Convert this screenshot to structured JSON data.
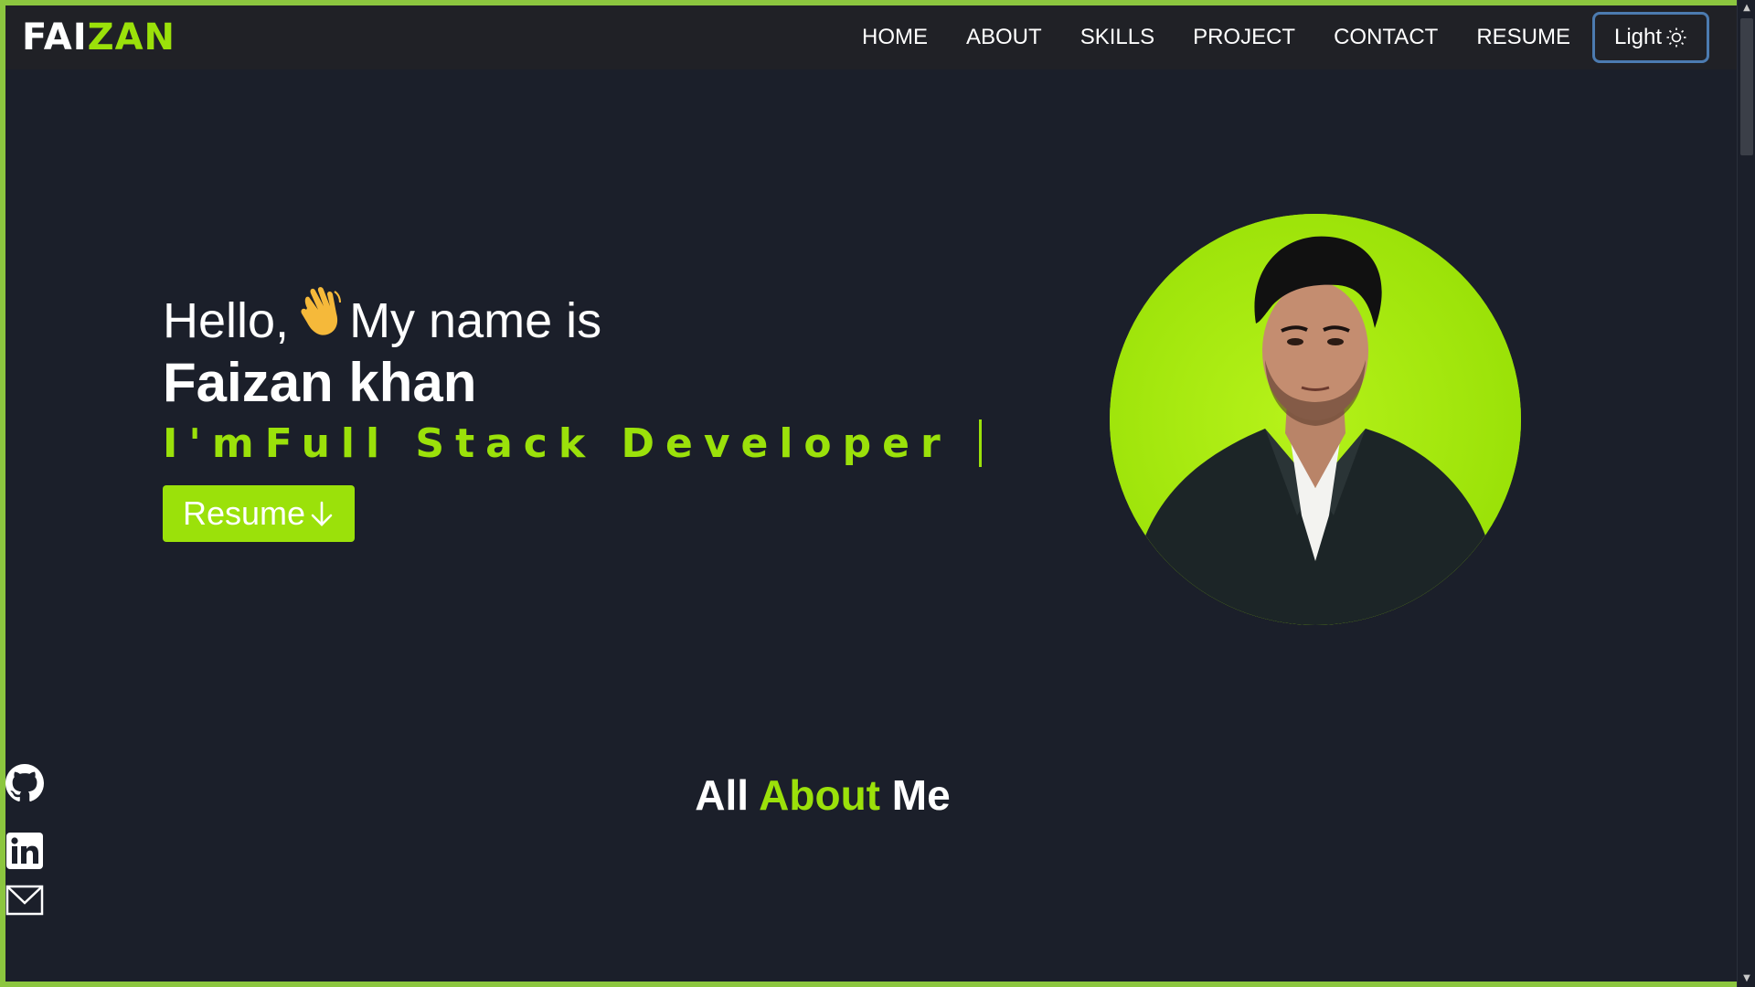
{
  "logo": {
    "part1": "FAI",
    "part2": "ZAN"
  },
  "nav": {
    "items": [
      {
        "label": "HOME"
      },
      {
        "label": "ABOUT"
      },
      {
        "label": "SKILLS"
      },
      {
        "label": "PROJECT"
      },
      {
        "label": "CONTACT"
      },
      {
        "label": "RESUME"
      }
    ],
    "theme_label": "Light",
    "theme_icon": "sun-icon"
  },
  "hero": {
    "greeting_prefix": "Hello,",
    "greeting_suffix": "My name is",
    "wave_icon": "waving-hand-icon",
    "name": "Faizan khan",
    "role_prefix": "I'm",
    "role_title": "Full Stack Developer",
    "resume_button": "Resume",
    "resume_icon": "arrow-down-icon"
  },
  "about": {
    "word1": "All",
    "word2": "About",
    "word3": "Me"
  },
  "social": {
    "icons": [
      "github-icon",
      "linkedin-icon",
      "mail-icon"
    ]
  },
  "colors": {
    "accent": "#9be10a",
    "background": "#1b1f2a",
    "navbar": "#202126",
    "theme_button_border": "#4c7bb0"
  }
}
